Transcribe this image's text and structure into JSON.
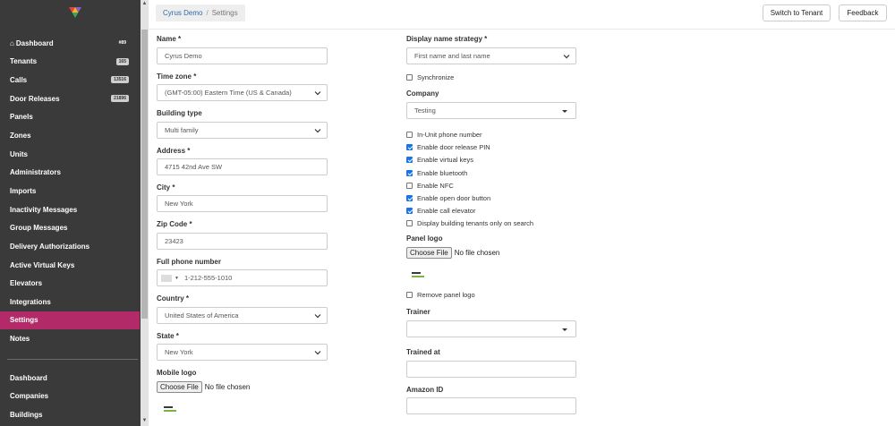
{
  "sidebar": {
    "items": [
      {
        "label": "Dashboard",
        "badge": "#89",
        "badge_plain": true,
        "icon": "home-icon"
      },
      {
        "label": "Tenants",
        "badge": "165"
      },
      {
        "label": "Calls",
        "badge": "13516"
      },
      {
        "label": "Door Releases",
        "badge": "21896"
      },
      {
        "label": "Panels"
      },
      {
        "label": "Zones"
      },
      {
        "label": "Units"
      },
      {
        "label": "Administrators"
      },
      {
        "label": "Imports"
      },
      {
        "label": "Inactivity Messages"
      },
      {
        "label": "Group Messages"
      },
      {
        "label": "Delivery Authorizations"
      },
      {
        "label": "Active Virtual Keys"
      },
      {
        "label": "Elevators"
      },
      {
        "label": "Integrations"
      },
      {
        "label": "Settings",
        "active": true
      },
      {
        "label": "Notes"
      }
    ],
    "items2": [
      {
        "label": "Dashboard"
      },
      {
        "label": "Companies"
      },
      {
        "label": "Buildings"
      }
    ],
    "active_color": "#b22a67"
  },
  "header": {
    "breadcrumb_link": "Cyrus Demo",
    "breadcrumb_sep": "/",
    "breadcrumb_current": "Settings",
    "switch_tenant": "Switch to Tenant",
    "feedback": "Feedback"
  },
  "form": {
    "name_label": "Name *",
    "name_value": "Cyrus Demo",
    "timezone_label": "Time zone *",
    "timezone_value": "(GMT-05:00) Eastern Time (US & Canada)",
    "building_type_label": "Building type",
    "building_type_value": "Multi family",
    "address_label": "Address *",
    "address_value": "4715 42nd Ave SW",
    "city_label": "City *",
    "city_value": "New York",
    "zip_label": "Zip Code *",
    "zip_value": "23423",
    "phone_label": "Full phone number",
    "phone_value": "1-212-555-1010",
    "country_label": "Country *",
    "country_value": "United States of America",
    "state_label": "State *",
    "state_value": "New York",
    "mobile_logo_label": "Mobile logo",
    "choose_file": "Choose File",
    "no_file": "No file chosen",
    "display_name_label": "Display name strategy *",
    "display_name_value": "First name and last name",
    "synchronize": "Synchronize",
    "company_label": "Company",
    "company_value": "Testing",
    "checks": [
      {
        "label": "In-Unit phone number",
        "checked": false
      },
      {
        "label": "Enable door release PIN",
        "checked": true
      },
      {
        "label": "Enable virtual keys",
        "checked": true
      },
      {
        "label": "Enable bluetooth",
        "checked": true
      },
      {
        "label": "Enable NFC",
        "checked": false
      },
      {
        "label": "Enable open door button",
        "checked": true
      },
      {
        "label": "Enable call elevator",
        "checked": true
      },
      {
        "label": "Display building tenants only on search",
        "checked": false
      }
    ],
    "panel_logo_label": "Panel logo",
    "remove_panel_logo": "Remove panel logo",
    "trainer_label": "Trainer",
    "trainer_value": "",
    "trained_at_label": "Trained at",
    "trained_at_value": "",
    "amazon_id_label": "Amazon ID",
    "amazon_id_value": ""
  }
}
